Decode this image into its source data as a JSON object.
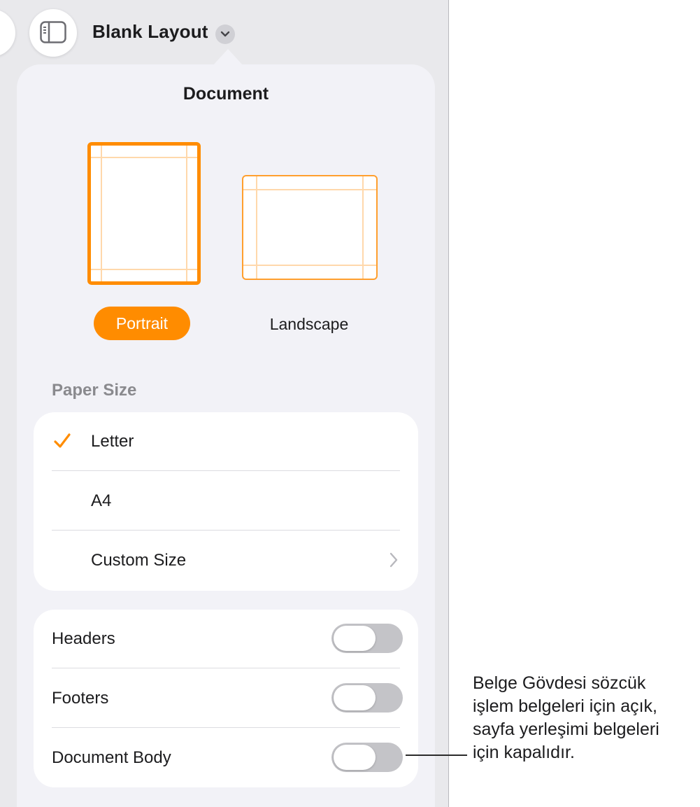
{
  "toolbar": {
    "document_title": "Blank Layout",
    "sidebar_icon": "sidebar-icon",
    "title_menu_icon": "chevron-down-icon"
  },
  "popover": {
    "title": "Document",
    "orientation": {
      "portrait_label": "Portrait",
      "landscape_label": "Landscape",
      "selected": "Portrait"
    },
    "paper_size": {
      "section_label": "Paper Size",
      "options": [
        {
          "label": "Letter",
          "selected": true
        },
        {
          "label": "A4",
          "selected": false
        },
        {
          "label": "Custom Size",
          "selected": false,
          "has_disclosure": true
        }
      ]
    },
    "toggles": [
      {
        "label": "Headers",
        "on": false
      },
      {
        "label": "Footers",
        "on": false
      },
      {
        "label": "Document Body",
        "on": false
      }
    ]
  },
  "callout": {
    "lines": [
      "Belge Gövdesi sözcük",
      "işlem belgeleri için açık,",
      "sayfa yerleşimi belgeleri",
      "için kapalıdır."
    ]
  },
  "colors": {
    "accent": "#ff8c00",
    "toggle_off": "#c4c4c8",
    "popover_bg": "#f2f2f7",
    "background": "#e9e9ec"
  }
}
